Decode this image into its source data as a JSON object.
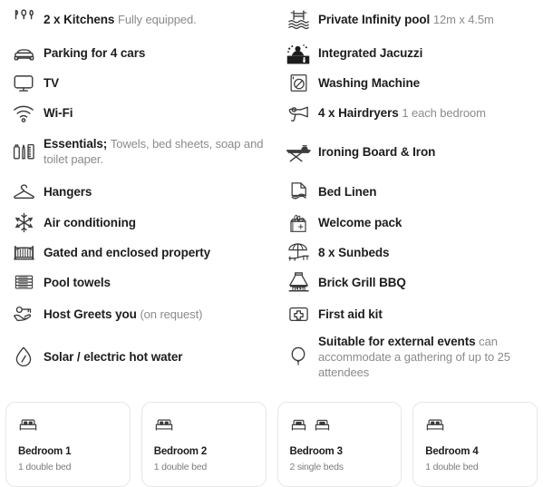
{
  "amenities": {
    "left_column": [
      {
        "icon": "kitchen-utensils-icon",
        "title": "2 x Kitchens",
        "detail": "Fully equipped."
      },
      {
        "icon": "car-icon",
        "title": "Parking for 4 cars",
        "detail": ""
      },
      {
        "icon": "tv-icon",
        "title": "TV",
        "detail": ""
      },
      {
        "icon": "wifi-icon",
        "title": "Wi-Fi",
        "detail": ""
      },
      {
        "icon": "toiletries-icon",
        "title": "Essentials;",
        "detail": "Towels, bed sheets, soap and toilet paper."
      },
      {
        "icon": "hanger-icon",
        "title": "Hangers",
        "detail": ""
      },
      {
        "icon": "snowflake-icon",
        "title": "Air conditioning",
        "detail": ""
      },
      {
        "icon": "gate-icon",
        "title": "Gated and enclosed property",
        "detail": ""
      },
      {
        "icon": "folded-towels-icon",
        "title": "Pool towels",
        "detail": ""
      },
      {
        "icon": "hand-key-icon",
        "title": "Host Greets you",
        "detail": "(on request)"
      },
      {
        "icon": "water-drop-icon",
        "title": "Solar / electric hot water",
        "detail": ""
      }
    ],
    "right_column": [
      {
        "icon": "infinity-pool-icon",
        "title": "Private Infinity pool",
        "detail": "12m x 4.5m"
      },
      {
        "icon": "jacuzzi-icon",
        "title": "Integrated Jacuzzi",
        "detail": ""
      },
      {
        "icon": "washing-machine-icon",
        "title": "Washing Machine",
        "detail": ""
      },
      {
        "icon": "hairdryer-icon",
        "title": "4 x Hairdryers",
        "detail": "1 each bedroom"
      },
      {
        "icon": "ironing-board-icon",
        "title": "Ironing Board & Iron",
        "detail": ""
      },
      {
        "icon": "bed-linen-icon",
        "title": "Bed Linen",
        "detail": ""
      },
      {
        "icon": "welcome-pack-icon",
        "title": "Welcome pack",
        "detail": ""
      },
      {
        "icon": "sunbed-icon",
        "title": "8 x Sunbeds",
        "detail": ""
      },
      {
        "icon": "bbq-grill-icon",
        "title": "Brick Grill BBQ",
        "detail": ""
      },
      {
        "icon": "first-aid-icon",
        "title": "First aid kit",
        "detail": ""
      },
      {
        "icon": "balloon-icon",
        "title": "Suitable for external events",
        "detail": "can accommodate a gathering of up to 25 attendees"
      }
    ]
  },
  "bedrooms": [
    {
      "icon": "double-bed-icon",
      "beds": 1,
      "name": "Bedroom 1",
      "description": "1 double bed"
    },
    {
      "icon": "double-bed-icon",
      "beds": 1,
      "name": "Bedroom 2",
      "description": "1 double bed"
    },
    {
      "icon": "single-bed-icon",
      "beds": 2,
      "name": "Bedroom 3",
      "description": "2 single beds"
    },
    {
      "icon": "double-bed-icon",
      "beds": 1,
      "name": "Bedroom 4",
      "description": "1 double bed"
    }
  ],
  "colors": {
    "text": "#1d1d1d",
    "muted": "#8b8b8b",
    "card_border": "#e6e6e6",
    "background": "#ffffff",
    "icon": "#3c3c3c"
  }
}
